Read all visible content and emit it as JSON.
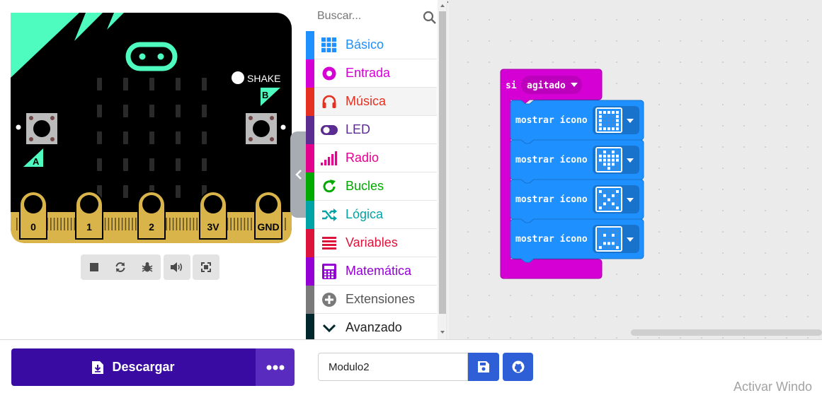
{
  "simulator": {
    "shake_label": "SHAKE",
    "button_a_label": "A",
    "button_b_label": "B",
    "pins": [
      "0",
      "1",
      "2",
      "3V",
      "GND"
    ],
    "toolbar_icons": [
      "stop-icon",
      "restart-icon",
      "debug-icon",
      "sound-icon",
      "fullscreen-icon"
    ]
  },
  "toolbox": {
    "search_placeholder": "Buscar...",
    "categories": [
      {
        "label": "Básico",
        "color": "#1e90ff",
        "icon": "grid-icon"
      },
      {
        "label": "Entrada",
        "color": "#d400d4",
        "icon": "input-icon"
      },
      {
        "label": "Música",
        "color": "#e63022",
        "icon": "headphones-icon"
      },
      {
        "label": "LED",
        "color": "#5c2d91",
        "icon": "toggle-icon"
      },
      {
        "label": "Radio",
        "color": "#e3008c",
        "icon": "signal-icon"
      },
      {
        "label": "Bucles",
        "color": "#00aa00",
        "icon": "loop-icon"
      },
      {
        "label": "Lógica",
        "color": "#00a4a6",
        "icon": "shuffle-icon"
      },
      {
        "label": "Variables",
        "color": "#dc143c",
        "icon": "list-icon"
      },
      {
        "label": "Matemática",
        "color": "#9400d3",
        "icon": "calculator-icon"
      },
      {
        "label": "Extensiones",
        "color": "#7a7a7a",
        "icon": "plus-circle-icon"
      },
      {
        "label": "Avanzado",
        "color": "#00272b",
        "icon": "chevron-down-icon"
      }
    ]
  },
  "workspace": {
    "event_block": {
      "keyword": "si",
      "dropdown_value": "agitado",
      "color": "#d400d4"
    },
    "show_icon_blocks": [
      {
        "label": "mostrar ícono",
        "color": "#1e90ff",
        "icon": "square"
      },
      {
        "label": "mostrar ícono",
        "color": "#1e90ff",
        "icon": "heart"
      },
      {
        "label": "mostrar ícono",
        "color": "#1e90ff",
        "icon": "x"
      },
      {
        "label": "mostrar ícono",
        "color": "#1e90ff",
        "icon": "sad"
      }
    ]
  },
  "bottombar": {
    "download_label": "Descargar",
    "project_name": "Modulo2",
    "watermark": "Activar Windo"
  }
}
